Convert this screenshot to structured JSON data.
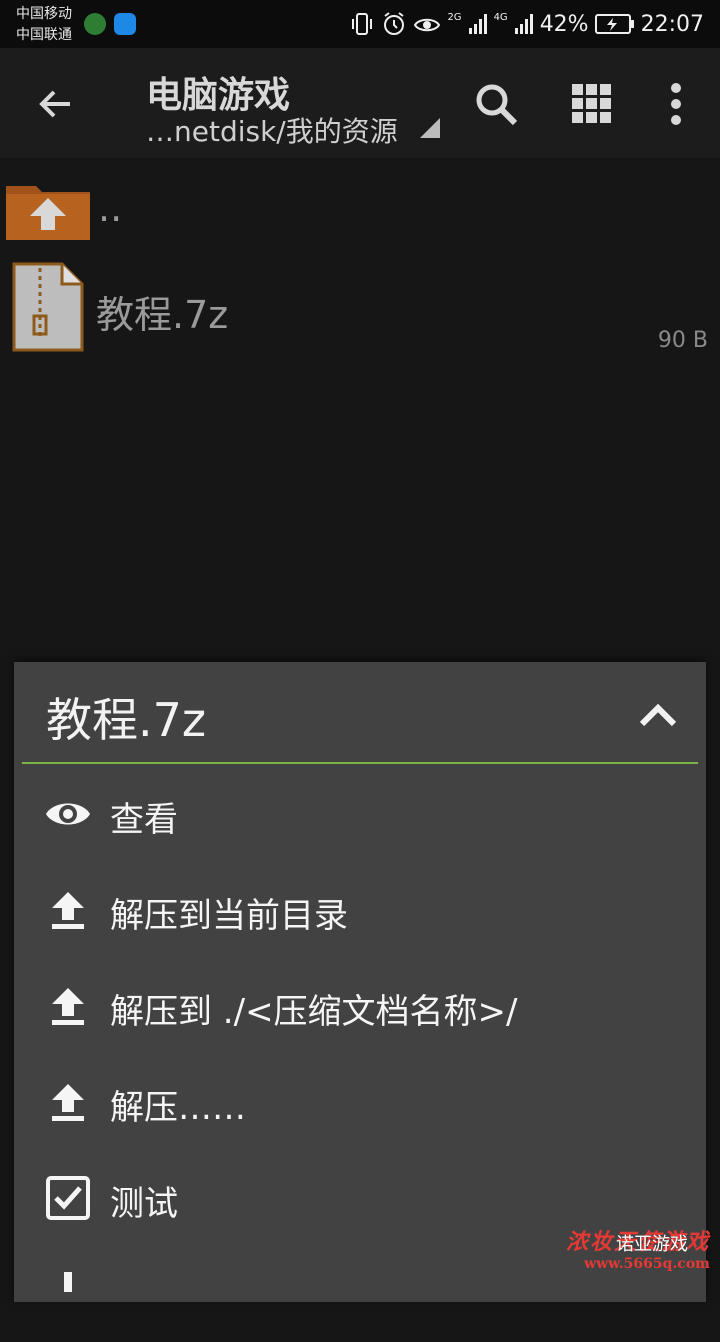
{
  "status_bar": {
    "carrier1": "中国移动",
    "carrier2": "中国联通",
    "network1": "2G",
    "network2": "4G",
    "battery": "42%",
    "time": "22:07"
  },
  "toolbar": {
    "title": "电脑游戏",
    "path": "…netdisk/我的资源",
    "icons": [
      "back-arrow-icon",
      "search-icon",
      "grid-view-icon",
      "more-vert-icon"
    ]
  },
  "files": [
    {
      "name": "..",
      "size": "",
      "icon": "parent-folder-icon"
    },
    {
      "name": "教程.7z",
      "size": "90 B",
      "icon": "archive-file-icon"
    }
  ],
  "sheet": {
    "title": "教程.7z",
    "accent": "#7cb342",
    "items": [
      {
        "label": "查看",
        "icon": "eye-icon"
      },
      {
        "label": "解压到当前目录",
        "icon": "extract-icon"
      },
      {
        "label": "解压到 ./<压缩文档名称>/",
        "icon": "extract-icon"
      },
      {
        "label": "解压……",
        "icon": "extract-icon"
      },
      {
        "label": "测试",
        "icon": "checkbox-icon"
      }
    ]
  },
  "watermark": {
    "brand": "诺亚游戏",
    "line1": "浓妆天使游戏",
    "url": "www.5665q.com"
  }
}
